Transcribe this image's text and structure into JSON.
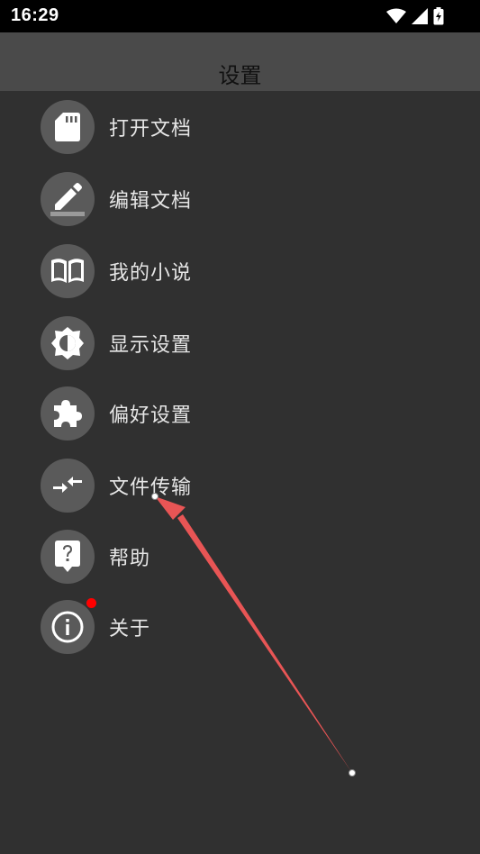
{
  "status_bar": {
    "time": "16:29",
    "icons": [
      "wifi-icon",
      "signal-icon",
      "battery-icon"
    ]
  },
  "header": {
    "title": "设置"
  },
  "menu": {
    "items": [
      {
        "label": "打开文档",
        "icon": "sd-card-icon"
      },
      {
        "label": "编辑文档",
        "icon": "edit-pencil-icon"
      },
      {
        "label": "我的小说",
        "icon": "book-icon"
      },
      {
        "label": "显示设置",
        "icon": "brightness-icon"
      },
      {
        "label": "偏好设置",
        "icon": "puzzle-icon"
      },
      {
        "label": "文件传输",
        "icon": "transfer-arrows-icon"
      },
      {
        "label": "帮助",
        "icon": "help-icon"
      },
      {
        "label": "关于",
        "icon": "info-icon",
        "badge": true
      }
    ]
  },
  "colors": {
    "background": "#303030",
    "header": "#4a4a4a",
    "icon_circle": "#5a5a5a",
    "badge": "#ff0000",
    "annotation_arrow": "#e85555"
  }
}
